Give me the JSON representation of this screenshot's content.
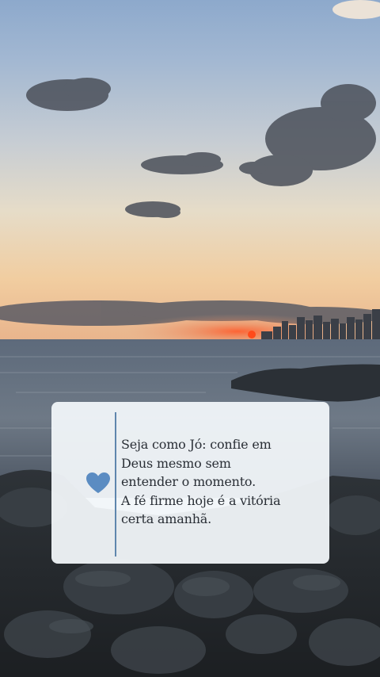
{
  "quote": {
    "lines": [
      "Seja como Jó: confie em",
      "Deus mesmo sem",
      "entender o momento.",
      "A fé firme hoje é a vitória",
      "certa amanhã."
    ],
    "icon": "heart-icon",
    "accent_color": "#5b8cc2"
  },
  "colors": {
    "card_background": "#f1f5f9",
    "divider": "#5f86ad",
    "text": "#2a2f36"
  }
}
